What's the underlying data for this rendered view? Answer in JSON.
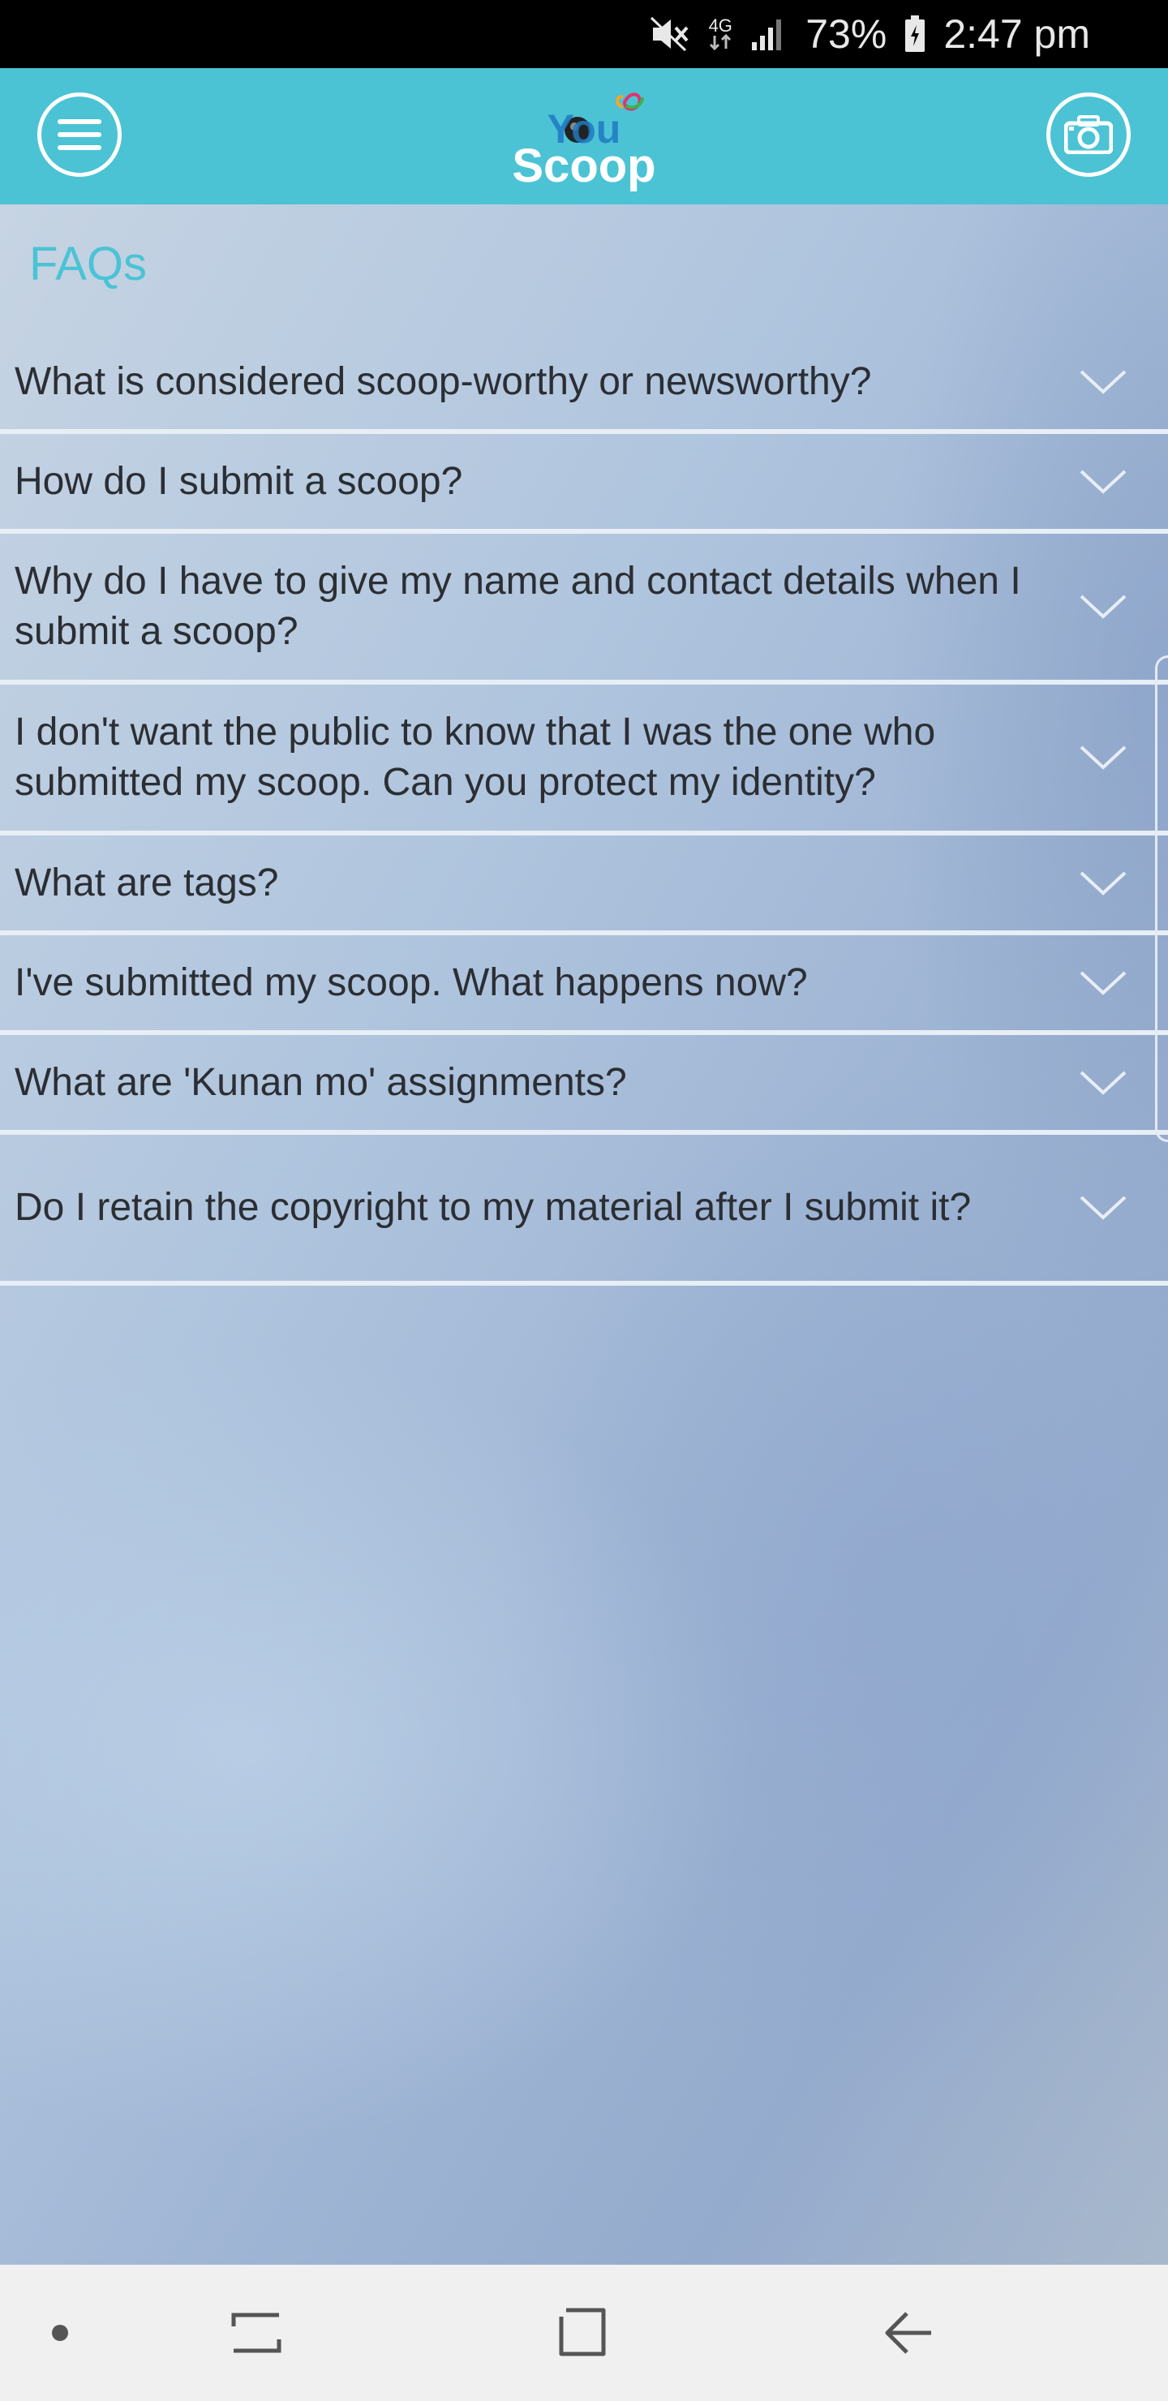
{
  "status_bar": {
    "network": "4G",
    "battery": "73%",
    "time": "2:47 pm",
    "icons": [
      "mute-icon",
      "network-4g-icon",
      "signal-icon",
      "battery-charging-icon"
    ]
  },
  "header": {
    "logo_text_top": "You",
    "logo_text_bottom": "Scoop",
    "menu_icon": "hamburger-menu-icon",
    "camera_icon": "camera-icon",
    "accent_color": "#4bc3d5"
  },
  "main": {
    "title": "FAQs",
    "faqs": [
      {
        "question": "What is considered scoop-worthy or newsworthy?"
      },
      {
        "question": "How do I submit a scoop?"
      },
      {
        "question": "Why do I have to give my name and contact details when I submit a scoop?"
      },
      {
        "question": "I don't want the public to know that I was the one who submitted my scoop. Can you protect my identity?"
      },
      {
        "question": "What are tags?"
      },
      {
        "question": "I've submitted my scoop. What happens now?"
      },
      {
        "question": "What are 'Kunan mo' assignments?"
      },
      {
        "question": "Do I retain the copyright to my material after I submit it?"
      }
    ]
  },
  "nav_bar": {
    "icons": [
      "dot-icon",
      "recent-apps-icon",
      "home-icon",
      "back-icon"
    ]
  }
}
